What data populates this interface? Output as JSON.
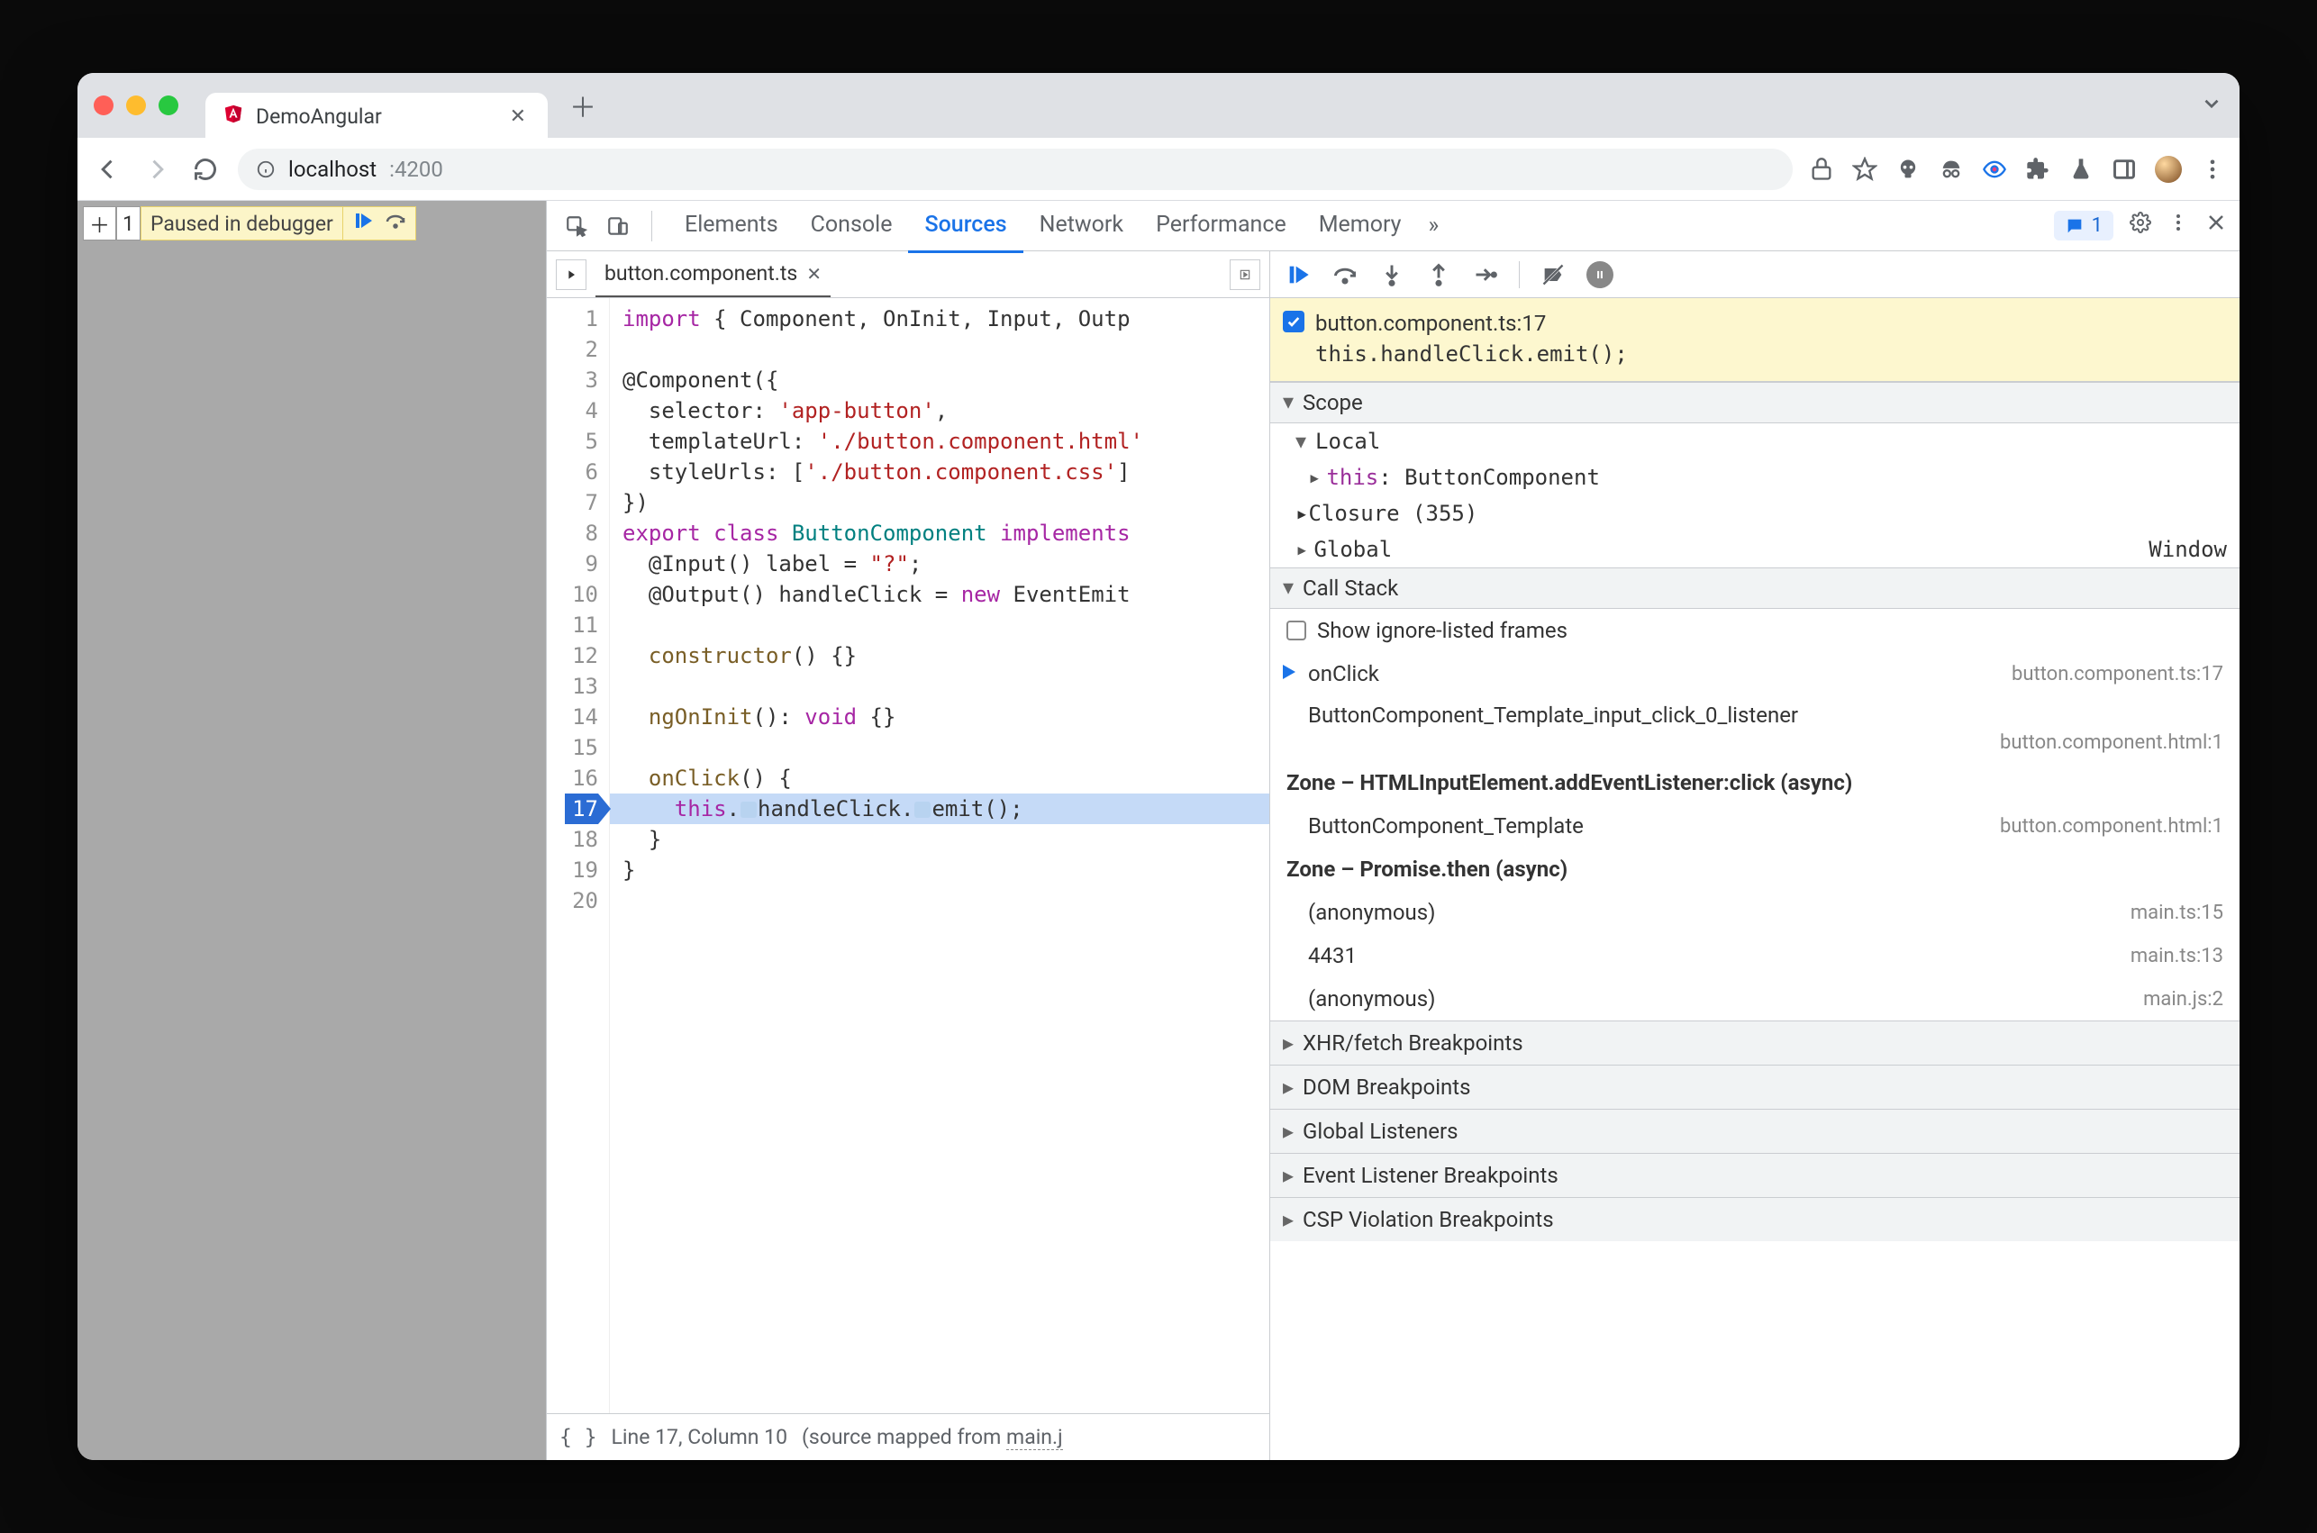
{
  "browser": {
    "tab_title": "DemoAngular",
    "url_host": "localhost",
    "url_port": ":4200"
  },
  "page": {
    "pause_msg": "Paused in debugger",
    "plus_label": "1"
  },
  "devtools": {
    "tabs": [
      "Elements",
      "Console",
      "Sources",
      "Network",
      "Performance",
      "Memory"
    ],
    "active_tab": "Sources",
    "more": "»",
    "issues_count": "1"
  },
  "sources": {
    "filename": "button.component.ts",
    "lines": [
      {
        "n": 1,
        "html": "<span class='tok-kw'>import</span> { Component, OnInit, Input, Outp"
      },
      {
        "n": 2,
        "html": ""
      },
      {
        "n": 3,
        "html": "@Component({"
      },
      {
        "n": 4,
        "html": "  selector: <span class='tok-sel'>'app-button'</span>,"
      },
      {
        "n": 5,
        "html": "  templateUrl: <span class='tok-sel'>'./button.component.html'</span>"
      },
      {
        "n": 6,
        "html": "  styleUrls: [<span class='tok-sel'>'./button.component.css'</span>]"
      },
      {
        "n": 7,
        "html": "})"
      },
      {
        "n": 8,
        "html": "<span class='tok-kw'>export</span> <span class='tok-kw'>class</span> <span class='tok-cls'>ButtonComponent</span> <span class='tok-kw'>implements</span>"
      },
      {
        "n": 9,
        "html": "  @Input() label = <span class='tok-str'>\"?\"</span>;"
      },
      {
        "n": 10,
        "html": "  @Output() handleClick = <span class='tok-new'>new</span> EventEmit"
      },
      {
        "n": 11,
        "html": ""
      },
      {
        "n": 12,
        "html": "  <span class='tok-mth'>constructor</span>() {}"
      },
      {
        "n": 13,
        "html": ""
      },
      {
        "n": 14,
        "html": "  <span class='tok-mth'>ngOnInit</span>(): <span class='tok-void'>void</span> {}"
      },
      {
        "n": 15,
        "html": ""
      },
      {
        "n": 16,
        "html": "  <span class='tok-mth'>onClick</span>() {"
      },
      {
        "n": 17,
        "html": "    <span class='tok-this'>this</span>.<span class='badge'></span>handleClick.<span class='badge'></span>emit();",
        "hl": true
      },
      {
        "n": 18,
        "html": "  }"
      },
      {
        "n": 19,
        "html": "}"
      },
      {
        "n": 20,
        "html": ""
      }
    ],
    "status_line": "Line 17, Column 10",
    "status_map_prefix": "(source mapped from ",
    "status_map_file": "main.j"
  },
  "debug": {
    "bp_file": "button.component.ts:17",
    "bp_code": "this.handleClick.emit();",
    "scope_title": "Scope",
    "scope_local": "Local",
    "scope_this_k": "this",
    "scope_this_v": "ButtonComponent",
    "scope_closure": "Closure (355)",
    "scope_global": "Global",
    "scope_window": "Window",
    "callstack_title": "Call Stack",
    "show_ignore": "Show ignore-listed frames",
    "frames": [
      {
        "fn": "onClick",
        "src": "button.component.ts:17",
        "current": true
      },
      {
        "fn": "ButtonComponent_Template_input_click_0_listener",
        "src": "button.component.html:1",
        "two": true
      },
      {
        "fn": "Zone – HTMLInputElement.addEventListener:click (async)",
        "async": true
      },
      {
        "fn": "ButtonComponent_Template",
        "src": "button.component.html:1"
      },
      {
        "fn": "Zone – Promise.then (async)",
        "async": true
      },
      {
        "fn": "(anonymous)",
        "src": "main.ts:15"
      },
      {
        "fn": "4431",
        "src": "main.ts:13"
      },
      {
        "fn": "(anonymous)",
        "src": "main.js:2"
      }
    ],
    "collapsed": [
      "XHR/fetch Breakpoints",
      "DOM Breakpoints",
      "Global Listeners",
      "Event Listener Breakpoints",
      "CSP Violation Breakpoints"
    ]
  }
}
